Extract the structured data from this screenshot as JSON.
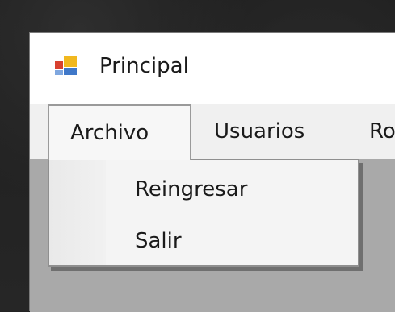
{
  "window": {
    "title": "Principal",
    "icon": "app-window-icon"
  },
  "menubar": {
    "items": [
      {
        "label": "Archivo",
        "open": true
      },
      {
        "label": "Usuarios"
      },
      {
        "label": "Ro"
      }
    ]
  },
  "dropdown": {
    "parent": "Archivo",
    "items": [
      {
        "label": "Reingresar"
      },
      {
        "label": "Salir"
      }
    ]
  },
  "colors": {
    "menubar_bg": "#f0f0f0",
    "client_bg": "#a9a9a9",
    "desktop_bg": "#232323"
  }
}
